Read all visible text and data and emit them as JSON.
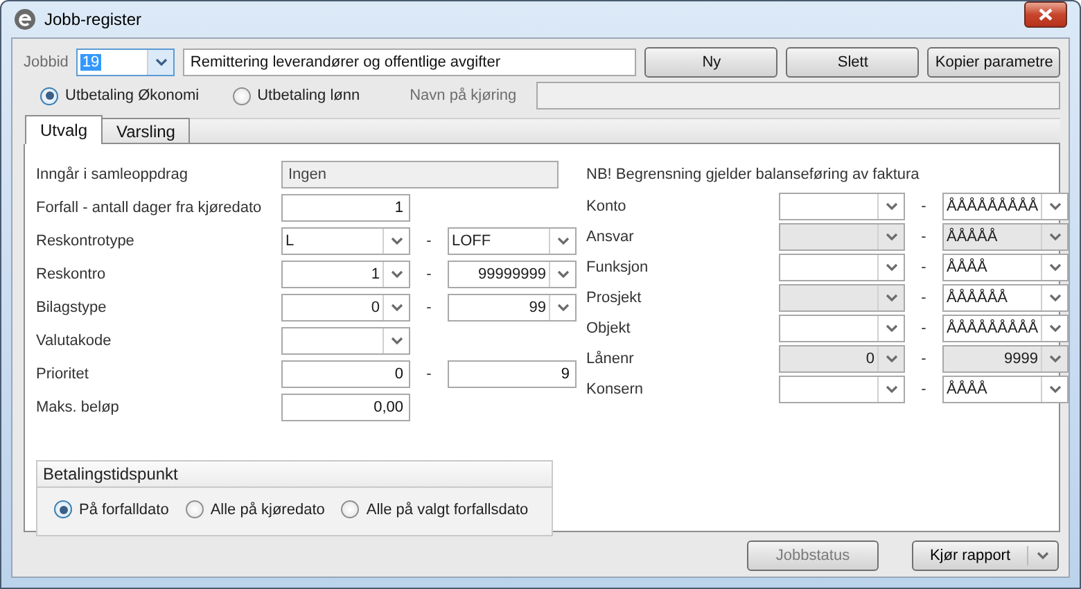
{
  "window": {
    "title": "Jobb-register"
  },
  "job": {
    "label": "Jobbid",
    "id": "19",
    "id_selected": true,
    "description": "Remittering leverandører og offentlige avgifter"
  },
  "top_buttons": [
    "Ny",
    "Slett",
    "Kopier parametre"
  ],
  "payment_source": [
    {
      "label": "Utbetaling Økonomi",
      "selected": true
    },
    {
      "label": "Utbetaling lønn",
      "selected": false
    }
  ],
  "run_name": {
    "label": "Navn på kjøring",
    "disabled": true
  },
  "tabs": [
    {
      "label": "Utvalg",
      "selected": true
    },
    {
      "label": "Varsling",
      "selected": false
    }
  ],
  "left_fields": [
    {
      "kind": "readonly",
      "label": "Inngår i samleoppdrag",
      "value": "Ingen"
    },
    {
      "kind": "input",
      "label": "Forfall - antall dager fra kjøredato",
      "value": "1"
    },
    {
      "kind": "combo_range",
      "label": "Reskontrotype",
      "numeric": false,
      "from": "L",
      "to": "LOFF"
    },
    {
      "kind": "combo_range",
      "label": "Reskontro",
      "numeric": true,
      "from": "1",
      "to": "99999999"
    },
    {
      "kind": "combo_range",
      "label": "Bilagstype",
      "numeric": true,
      "from": "0",
      "to": "99"
    },
    {
      "kind": "combo",
      "label": "Valutakode"
    },
    {
      "kind": "input_range",
      "label": "Prioritet",
      "from": "0",
      "to": "9"
    },
    {
      "kind": "input",
      "label": "Maks. beløp",
      "value": "0,00"
    }
  ],
  "note": "NB! Begrensning gjelder balanseføring av faktura",
  "right_fields": [
    {
      "label": "Konto",
      "from": {
        "disabled": false
      },
      "to": {
        "value": "ÅÅÅÅÅÅÅÅÅ",
        "disabled": false
      }
    },
    {
      "label": "Ansvar",
      "from": {
        "disabled": true
      },
      "to": {
        "value": "ÅÅÅÅÅ",
        "disabled": true
      }
    },
    {
      "label": "Funksjon",
      "from": {
        "disabled": false
      },
      "to": {
        "value": "ÅÅÅÅ",
        "disabled": false
      }
    },
    {
      "label": "Prosjekt",
      "from": {
        "disabled": true
      },
      "to": {
        "value": "ÅÅÅÅÅÅ",
        "disabled": false
      }
    },
    {
      "label": "Objekt",
      "from": {
        "disabled": false
      },
      "to": {
        "value": "ÅÅÅÅÅÅÅÅÅ",
        "disabled": false
      }
    },
    {
      "label": "Lånenr",
      "numeric": true,
      "from": {
        "value": "0",
        "disabled": true
      },
      "to": {
        "value": "9999",
        "disabled": true
      }
    },
    {
      "label": "Konsern",
      "from": {
        "disabled": false
      },
      "to": {
        "value": "ÅÅÅÅ",
        "disabled": false
      }
    }
  ],
  "dash": "-",
  "payment_time": {
    "title": "Betalingstidspunkt",
    "options": [
      {
        "label": "På forfalldato",
        "selected": true
      },
      {
        "label": "Alle på kjøredato",
        "selected": false
      },
      {
        "label": "Alle på valgt forfallsdato",
        "selected": false
      }
    ]
  },
  "bottom": {
    "status_button": {
      "label": "Jobbstatus",
      "disabled": true
    },
    "report_button": "Kjør rapport"
  }
}
